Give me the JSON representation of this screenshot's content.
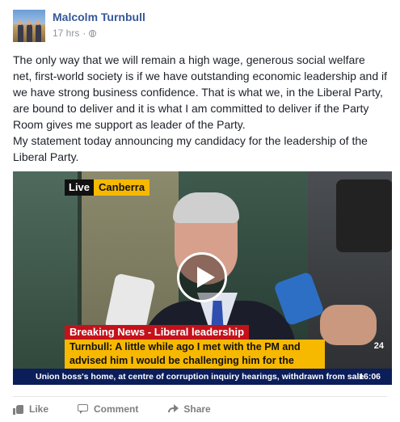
{
  "post": {
    "author": "Malcolm Turnbull",
    "time": "17 hrs",
    "separator": "·",
    "privacy_icon": "globe-icon",
    "paragraph1": "The only way that we will remain a high wage, generous social welfare net, first-world society is if we have outstanding economic leadership and if we have strong business confidence. That is what we, in the Liberal Party, are bound to deliver and it is what I am committed to deliver if the Party Room gives me support as leader of the Party.",
    "paragraph2": "My statement today announcing my candidacy for the leadership of the Liberal Party."
  },
  "video": {
    "live_label": "Live",
    "location": "Canberra",
    "breaking_label": "Breaking News - Liberal leadership",
    "quote": "Turnbull: A little while ago I met with the PM and advised him I would be challenging him for the leadership",
    "ticker": "Union boss's home, at centre of corruption inquiry hearings, withdrawn from sale",
    "clock": "16:06",
    "channel": "24",
    "play_icon": "play-icon"
  },
  "actions": {
    "like": "Like",
    "comment": "Comment",
    "share": "Share"
  },
  "colors": {
    "author": "#365899",
    "breaking": "#c4121b",
    "caption": "#f7b800",
    "ticker": "#0b1e5a"
  }
}
